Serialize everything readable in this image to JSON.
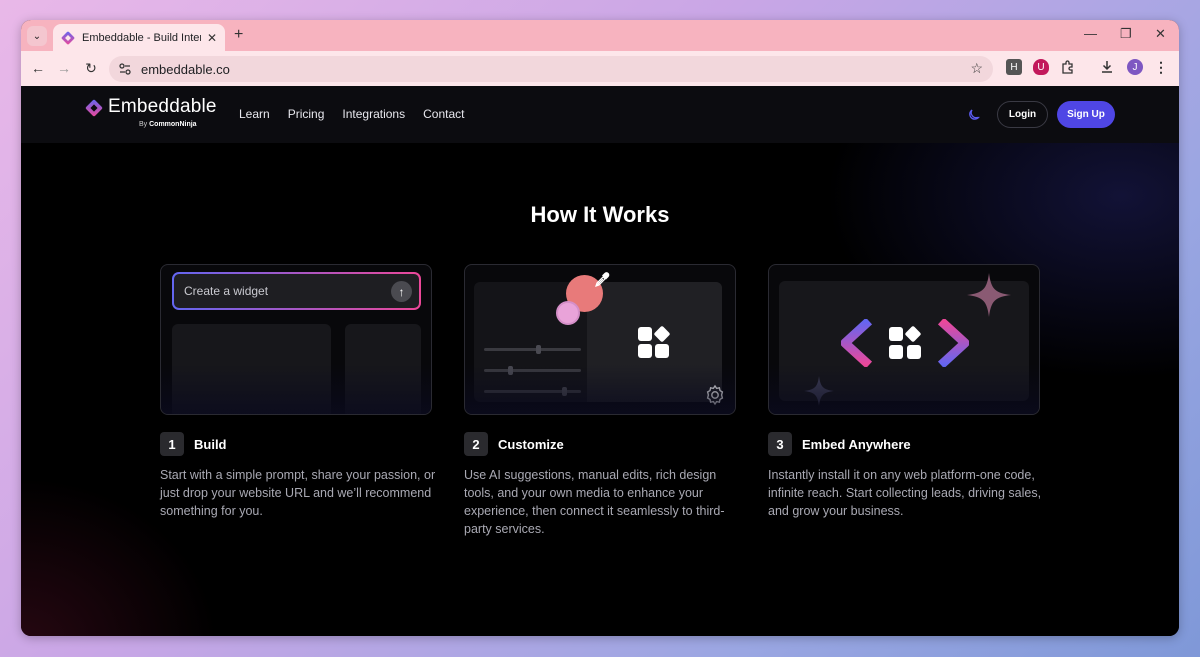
{
  "browser": {
    "tab_title": "Embeddable - Build Interactive",
    "new_tab": "+",
    "close_tab": "✕",
    "url": "embeddable.co",
    "profile_initial": "J",
    "ext_h": "H"
  },
  "header": {
    "logo_text": "Embeddable",
    "logo_by_prefix": "By",
    "logo_by_brand": "CommonNinja",
    "nav": [
      "Learn",
      "Pricing",
      "Integrations",
      "Contact"
    ],
    "login": "Login",
    "signup": "Sign Up"
  },
  "section": {
    "title": "How It Works",
    "prompt_placeholder": "Create a widget",
    "steps": [
      {
        "num": "1",
        "title": "Build",
        "desc": "Start with a simple prompt, share your passion, or just drop your website URL and we’ll recommend something for you."
      },
      {
        "num": "2",
        "title": "Customize",
        "desc": "Use AI suggestions, manual edits, rich design tools, and your own media to enhance your experience, then connect it seamlessly to third-party services."
      },
      {
        "num": "3",
        "title": "Embed Anywhere",
        "desc": "Instantly install it on any web platform-one code, infinite reach. Start collecting leads, driving sales, and grow your business."
      }
    ]
  },
  "colors": {
    "accent": "#4f46e5",
    "tab_strip": "#f7b3bf",
    "toolbar": "#fde6ea",
    "gradient_start": "#6366f1",
    "gradient_end": "#ec4899"
  }
}
